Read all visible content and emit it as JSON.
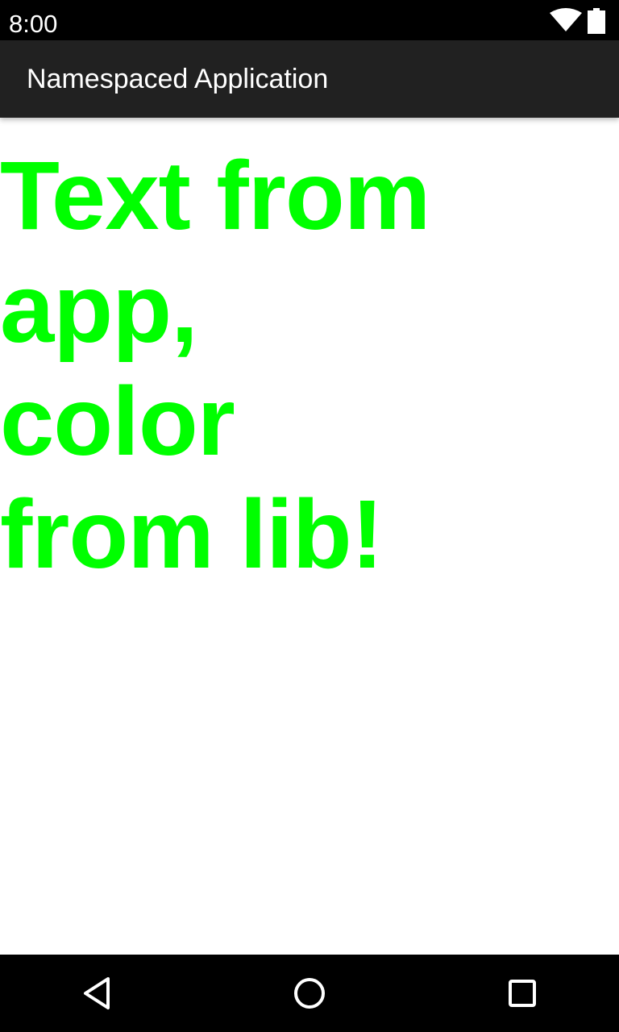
{
  "status_bar": {
    "time": "8:00",
    "icons": [
      "wifi-icon",
      "battery-icon"
    ]
  },
  "app_bar": {
    "title": "Namespaced Application"
  },
  "content": {
    "message": "Text from app, color from lib!",
    "message_color": "#00ff00"
  },
  "nav_bar": {
    "icons": [
      "back-icon",
      "home-icon",
      "recents-icon"
    ]
  },
  "colors": {
    "status_bar": "#000000",
    "app_bar": "#212121",
    "background": "#ffffff",
    "nav_bar": "#000000"
  }
}
